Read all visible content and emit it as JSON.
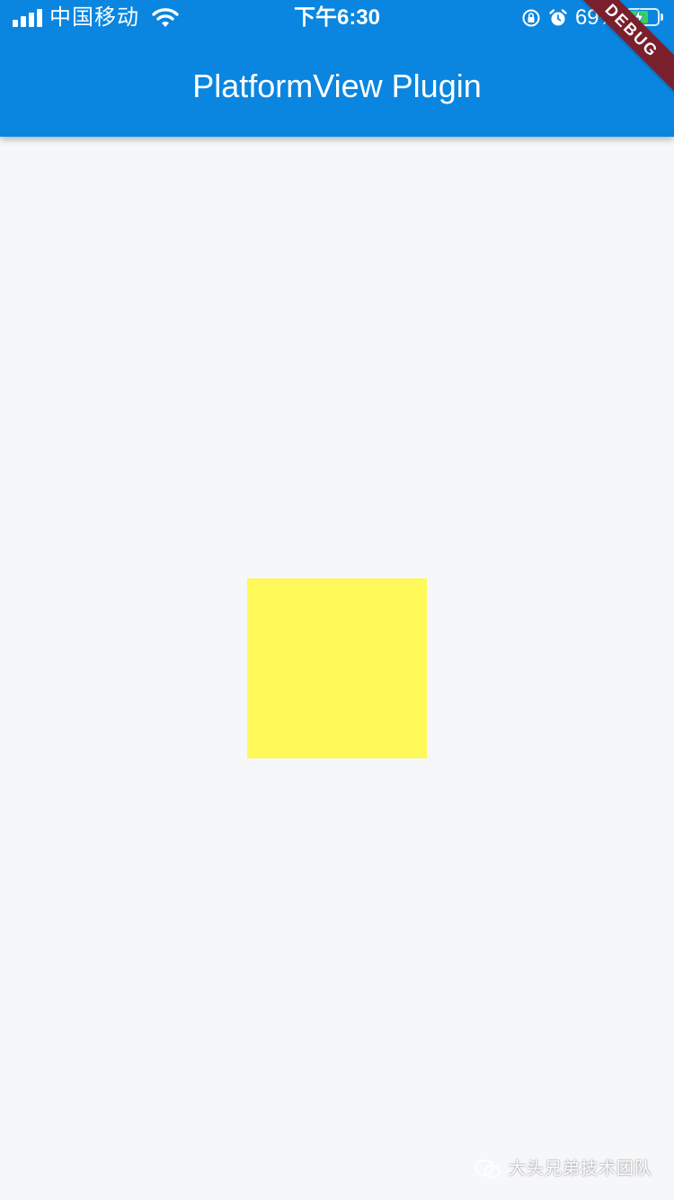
{
  "status_bar": {
    "carrier": "中国移动",
    "time": "下午6:30",
    "battery_percent": "69%",
    "battery_level": 0.69,
    "icons": [
      "signal-icon",
      "wifi-icon",
      "orientation-lock-icon",
      "alarm-icon",
      "battery-charging-icon"
    ]
  },
  "app_bar": {
    "title": "PlatformView Plugin",
    "color": "#0a86e0"
  },
  "debug_banner": {
    "label": "DEBUG",
    "color": "#7a1f2c"
  },
  "body": {
    "background": "#f6f7f9",
    "platform_view_color": "#fff859"
  },
  "watermark": {
    "text": "大头兄弟技术团队",
    "icon": "wechat-icon"
  }
}
